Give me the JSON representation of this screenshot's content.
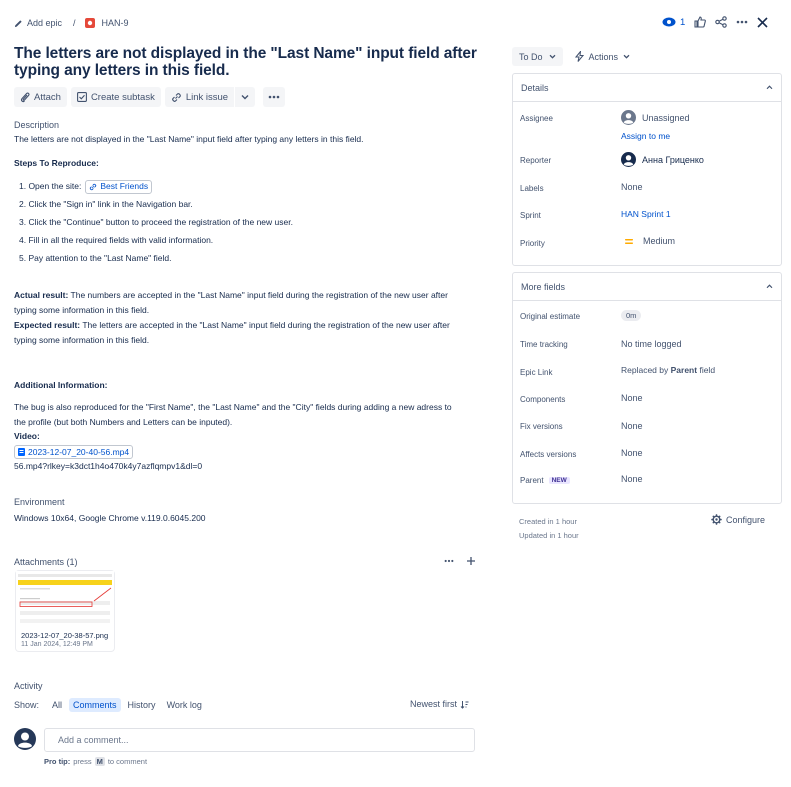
{
  "breadcrumb": {
    "add_epic": "Add epic",
    "separator": "/",
    "issue_key": "HAN-9"
  },
  "top_actions": {
    "watchers_count": "1"
  },
  "issue": {
    "title_line1": "The letters are not displayed in the \"Last Name\" input field after",
    "title_line2": "typing any letters in this field."
  },
  "toolbar": {
    "attach": "Attach",
    "create_subtask": "Create subtask",
    "link_issue": "Link issue"
  },
  "description": {
    "heading": "Description",
    "summary": "The letters are not displayed in the \"Last Name\" input field after typing any letters in this field.",
    "steps_heading": "Steps To Reproduce:",
    "step1_prefix": "1. Open the site:",
    "step1_link": "Best Friends",
    "step2": "2. Click the \"Sign in\" link in the Navigation bar.",
    "step3": "3. Click the \"Continue\" button to proceed the registration of the new user.",
    "step4": "4. Fill in all the required fields with valid information.",
    "step5": "5. Pay attention to the \"Last Name\" field.",
    "actual_label": "Actual result:",
    "actual_text1": " The numbers are accepted in the \"Last Name\" input field during the registration of the new user after",
    "actual_text2": "typing some information in this field.",
    "expected_label": "Expected result:",
    "expected_text1": " The letters are accepted in the \"Last Name\" input field during the registration of the new user after",
    "expected_text2": "typing some information in this field.",
    "additional_heading": "Additional Information:",
    "additional_text1": "The bug is also reproduced for the \"First Name\", the \"Last Name\" and the \"City\" fields during adding a new adress to",
    "additional_text2": "the profile (but both Numbers and Letters can be inputed).",
    "video_label": "Video:",
    "video_file": "2023-12-07_20-40-56.mp4",
    "video_tail": "56.mp4?rlkey=k3dct1h4o470k4y7azflqmpv1&dl=0"
  },
  "environment": {
    "heading": "Environment",
    "value": "Windows 10x64, Google Chrome v.119.0.6045.200"
  },
  "attachments": {
    "heading": "Attachments (1)",
    "file_name": "2023-12-07_20-38-57.png",
    "file_date": "11 Jan 2024, 12:49 PM"
  },
  "activity": {
    "heading": "Activity",
    "show_label": "Show:",
    "tabs": [
      "All",
      "Comments",
      "History",
      "Work log"
    ],
    "active_tab": "Comments",
    "sort_label": "Newest first",
    "comment_placeholder": "Add a comment...",
    "protip_label": "Pro tip:",
    "protip_text1": "press",
    "protip_key": "M",
    "protip_text2": "to comment"
  },
  "status": {
    "current": "To Do",
    "actions_label": "Actions"
  },
  "details": {
    "heading": "Details",
    "assignee_label": "Assignee",
    "assignee_value": "Unassigned",
    "assign_to_me": "Assign to me",
    "reporter_label": "Reporter",
    "reporter_value": "Анна Гриценко",
    "labels_label": "Labels",
    "labels_value": "None",
    "sprint_label": "Sprint",
    "sprint_value": "HAN Sprint 1",
    "priority_label": "Priority",
    "priority_value": "Medium"
  },
  "more_fields": {
    "heading": "More fields",
    "original_estimate_label": "Original estimate",
    "original_estimate_value": "0m",
    "time_tracking_label": "Time tracking",
    "time_tracking_value": "No time logged",
    "epic_link_label": "Epic Link",
    "epic_link_prefix": "Replaced by ",
    "epic_link_bold": "Parent",
    "epic_link_suffix": " field",
    "components_label": "Components",
    "components_value": "None",
    "fix_versions_label": "Fix versions",
    "fix_versions_value": "None",
    "affects_versions_label": "Affects versions",
    "affects_versions_value": "None",
    "parent_label": "Parent",
    "parent_badge": "NEW",
    "parent_value": "None"
  },
  "meta": {
    "created": "Created in 1 hour",
    "updated": "Updated in 1 hour",
    "configure": "Configure"
  },
  "colors": {
    "brand_blue": "#0052cc",
    "bug_red": "#e5493a",
    "priority_orange": "#ffab00",
    "text_dark": "#172b4d",
    "muted": "#6b778c"
  }
}
